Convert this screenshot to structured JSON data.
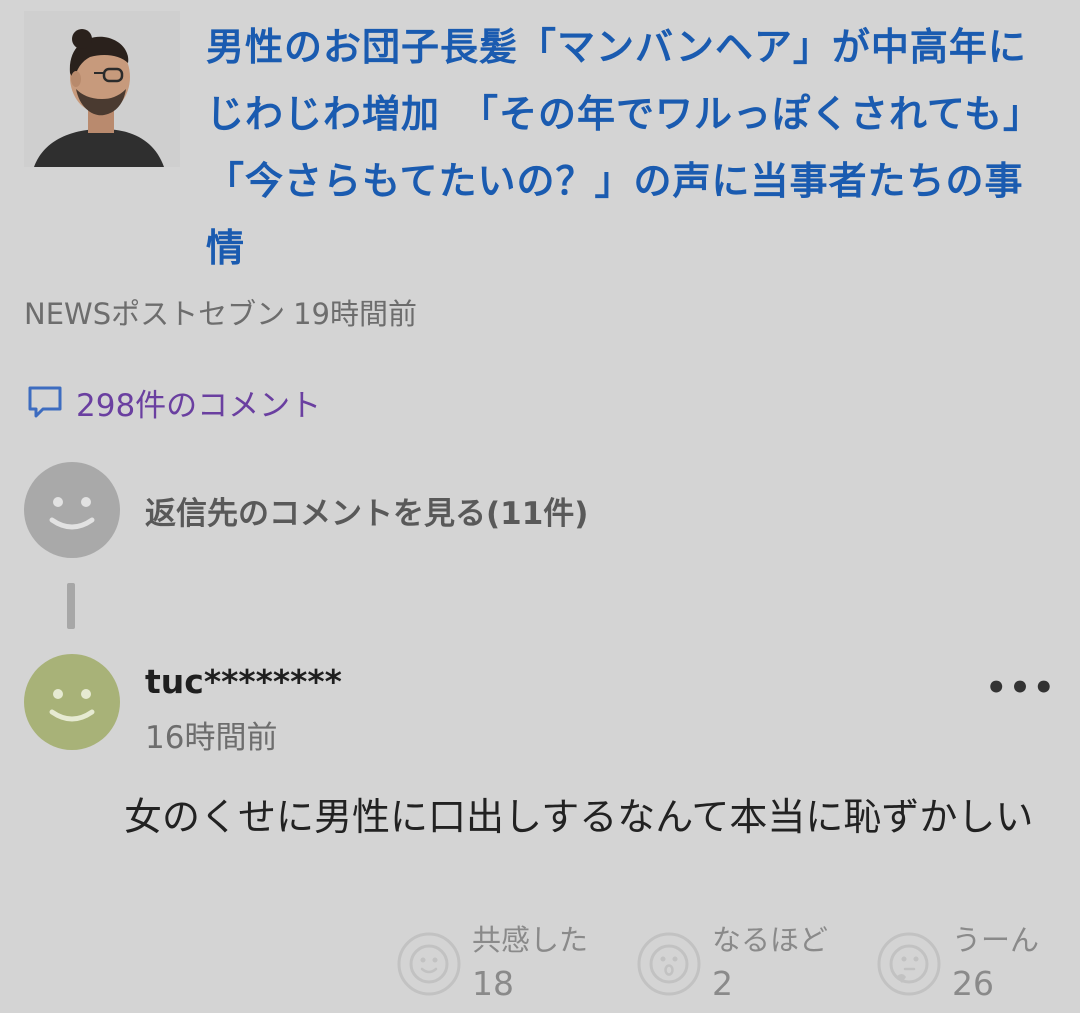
{
  "article": {
    "title": "男性のお団子長髪「マンバンヘア」が中高年にじわじわ増加　「その年でワルっぽくされても」「今さらもてたいの？」の声に当事者たちの事情",
    "source": "NEWSポストセブン",
    "time": "19時間前"
  },
  "comments_link": {
    "label": "298件のコメント"
  },
  "parent_comment": {
    "link_label": "返信先のコメントを見る(11件)"
  },
  "reply": {
    "username": "tuc********",
    "time": "16時間前",
    "more_label": "•••",
    "body": "女のくせに男性に口出しするなんて本当に恥ずかしい"
  },
  "reactions": [
    {
      "label": "共感した",
      "count": "18",
      "icon": "smile-face-icon"
    },
    {
      "label": "なるほど",
      "count": "2",
      "icon": "surprised-face-icon"
    },
    {
      "label": "うーん",
      "count": "26",
      "icon": "thinking-face-icon"
    }
  ],
  "colors": {
    "background": "#d4d4d4",
    "title_link": "#1a5bb0",
    "comment_link": "#6a3fa0",
    "avatar_gray": "#a9a9a9",
    "avatar_green": "#a8b278"
  }
}
